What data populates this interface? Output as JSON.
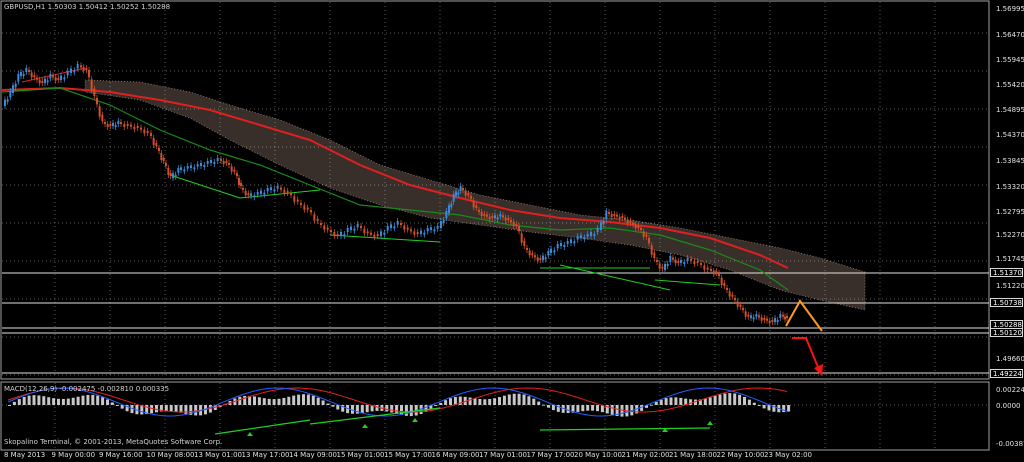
{
  "window": {
    "symbol_title": "GBPUSD,H1",
    "ohlc": "1.50303 1.50412 1.50252 1.50288",
    "copyright": "Skopalino Terminal, © 2001-2013, MetaQuotes Software Corp."
  },
  "price_axis": {
    "labels": [
      "1.56995",
      "1.56470",
      "1.55945",
      "1.55420",
      "1.54895",
      "1.54370",
      "1.53845",
      "1.53320",
      "1.52795",
      "1.52270",
      "1.51745",
      "1.51220",
      "1.49660"
    ],
    "boxes": [
      "1.51370",
      "1.50738",
      "1.50288",
      "1.50120",
      "1.49224"
    ]
  },
  "time_axis": {
    "labels": [
      "8 May 2013",
      "9 May 00:00",
      "9 May 16:00",
      "10 May 08:00",
      "13 May 01:00",
      "13 May 17:00",
      "14 May 09:00",
      "15 May 01:00",
      "15 May 17:00",
      "16 May 09:00",
      "17 May 01:00",
      "17 May 17:00",
      "20 May 10:00",
      "21 May 02:00",
      "21 May 18:00",
      "22 May 10:00",
      "23 May 02:00"
    ]
  },
  "macd": {
    "title": "MACD(12,26,9) -0.002475 -0.002810 0.000335",
    "levels": [
      "0.00224",
      "0.0000",
      "-0.00387"
    ]
  },
  "colors": {
    "bull_candle": "#3a8ad8",
    "bear_candle": "#d0502a",
    "ma_red": "#e02020",
    "ma_green": "#1a8a1a",
    "cloud": "#ffd8c0",
    "arrow_orange": "#ff9a20",
    "arrow_red": "#ff1010",
    "grid": "#808080"
  }
}
